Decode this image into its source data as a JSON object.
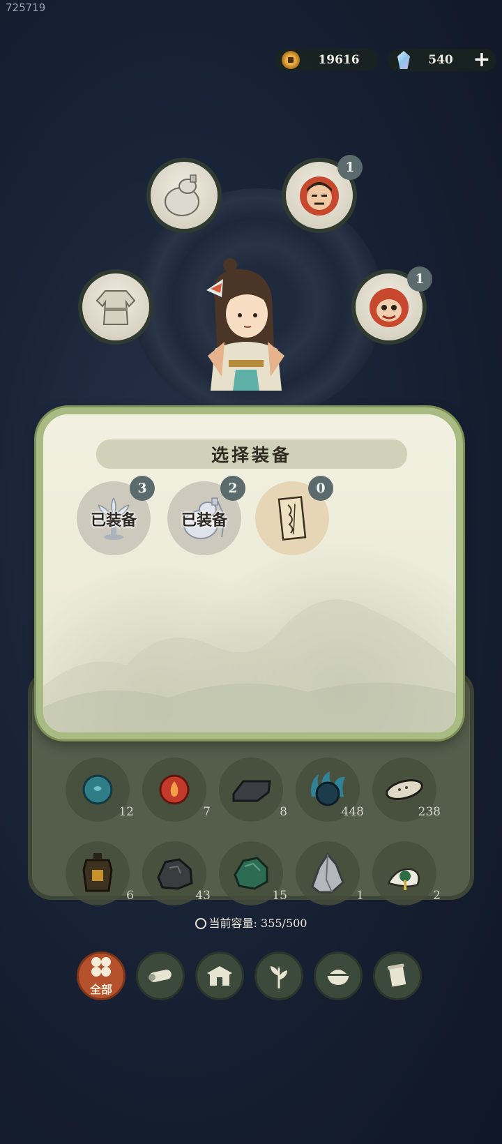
{
  "debug_id": "725719",
  "currency": {
    "coins": "19616",
    "gems": "540",
    "add_label": "+"
  },
  "equip_slots": [
    {
      "name": "gourd",
      "badge": ""
    },
    {
      "name": "mask-red-face",
      "badge": "1"
    },
    {
      "name": "robe",
      "badge": ""
    },
    {
      "name": "mask-demon",
      "badge": "1"
    }
  ],
  "dialog": {
    "title": "选择装备",
    "choices": [
      {
        "name": "lotus-lamp",
        "badge": "3",
        "status": "已装备"
      },
      {
        "name": "gourd",
        "badge": "2",
        "status": "已装备"
      },
      {
        "name": "talisman",
        "badge": "0",
        "status": ""
      }
    ]
  },
  "inventory": {
    "items": [
      {
        "name": "blue-orb",
        "count": "12"
      },
      {
        "name": "fire-orb",
        "count": "7"
      },
      {
        "name": "iron-ingot",
        "count": "8"
      },
      {
        "name": "spirit-orb",
        "count": "448"
      },
      {
        "name": "grain-seed",
        "count": "238"
      },
      {
        "name": "lantern-token",
        "count": "6"
      },
      {
        "name": "coal-ore",
        "count": "43"
      },
      {
        "name": "jade-ore",
        "count": "15"
      },
      {
        "name": "silver-crystal",
        "count": "1"
      },
      {
        "name": "fly-whisk",
        "count": "2"
      }
    ],
    "capacity_label": "当前容量",
    "capacity_value": "355/500"
  },
  "tabs": [
    {
      "name": "all",
      "label": "全部",
      "active": true
    },
    {
      "name": "wood"
    },
    {
      "name": "building"
    },
    {
      "name": "herb"
    },
    {
      "name": "food"
    },
    {
      "name": "scroll"
    }
  ],
  "colors": {
    "dialog_border": "#a7bb82",
    "active_tab": "#b5512c",
    "badge": "#5b6a6c"
  }
}
